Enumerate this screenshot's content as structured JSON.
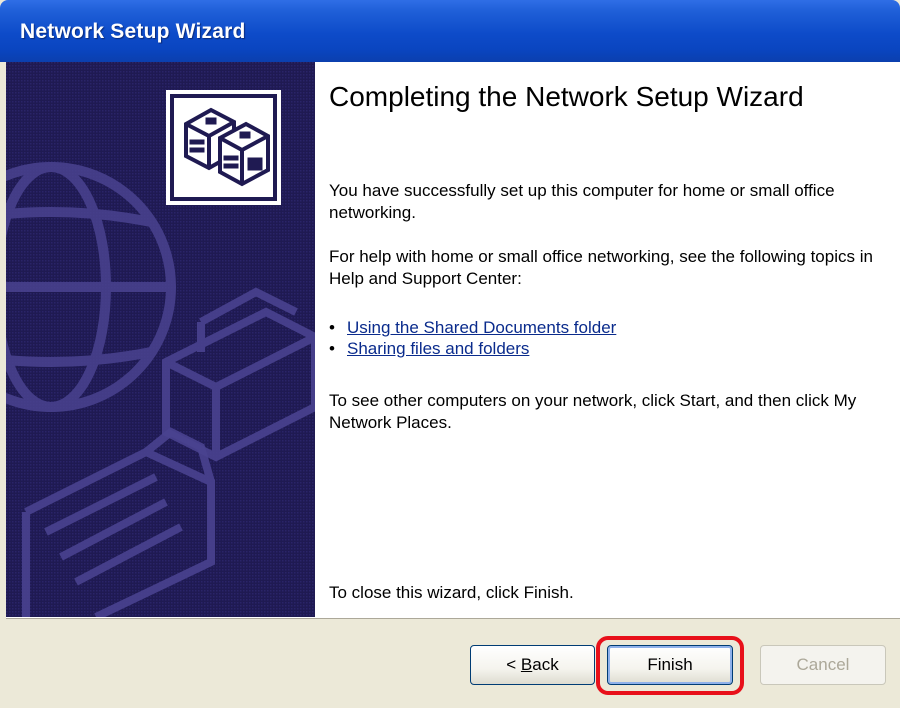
{
  "window": {
    "title": "Network Setup Wizard"
  },
  "content": {
    "heading": "Completing the Network Setup Wizard",
    "paragraph1": "You have successfully set up this computer for home or small office networking.",
    "paragraph2": "For help with home or small office networking, see the following topics in Help and Support Center:",
    "links": [
      {
        "label": "Using the Shared Documents folder"
      },
      {
        "label": "Sharing files and folders"
      }
    ],
    "paragraph3": "To see other computers on your network, click Start, and then click My Network Places.",
    "paragraph4": "To close this wizard, click Finish."
  },
  "buttons": {
    "back_prefix": "< ",
    "back_accel": "B",
    "back_rest": "ack",
    "finish": "Finish",
    "cancel": "Cancel"
  },
  "colors": {
    "titlebar": "#0a45c0",
    "side_panel": "#1f1a52",
    "highlight": "#e8101a",
    "link": "#0a2b8c"
  },
  "icons": {
    "side_panel": [
      "network-computers-icon",
      "globe-graphic",
      "printer-graphic",
      "folder-graphic"
    ]
  }
}
